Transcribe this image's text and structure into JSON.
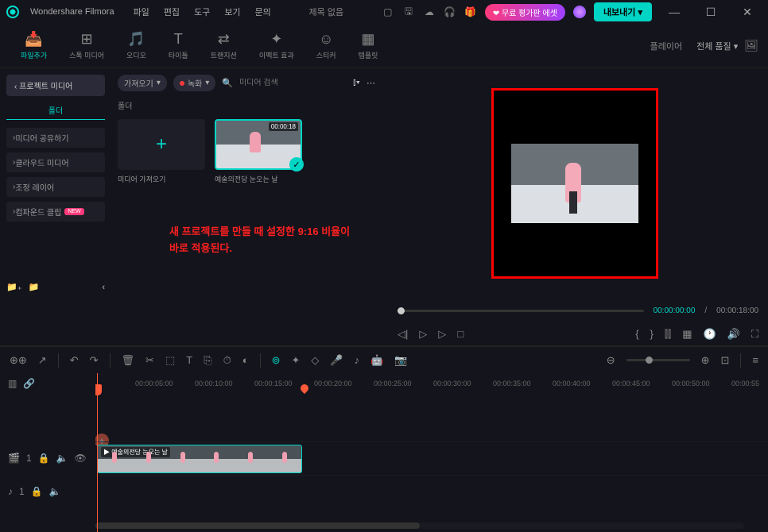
{
  "app": {
    "name": "Wondershare Filmora",
    "title": "제목 없음"
  },
  "menu": [
    "파일",
    "편집",
    "도구",
    "보기",
    "문의"
  ],
  "titlebar_asset": "❤ 무료 평가판 에셋",
  "export_label": "내보내기",
  "tool_tabs": [
    {
      "icon": "📥",
      "label": "파일추가"
    },
    {
      "icon": "⊞",
      "label": "스톡 미디어"
    },
    {
      "icon": "🎵",
      "label": "오디오"
    },
    {
      "icon": "T",
      "label": "타이틀"
    },
    {
      "icon": "⇄",
      "label": "트랜지션"
    },
    {
      "icon": "✦",
      "label": "이펙트 효과"
    },
    {
      "icon": "☺",
      "label": "스티커"
    },
    {
      "icon": "▦",
      "label": "템플릿"
    }
  ],
  "sidebar": {
    "project_media": "‹  프로젝트 미디어",
    "folder": "폴더",
    "items": [
      "미디어 공유하기",
      "클라우드 미디어",
      "조정 레이어",
      "컴파운드 클립"
    ],
    "new_badge": "NEW"
  },
  "media_toolbar": {
    "import": "가져오기",
    "record": "녹화",
    "search_placeholder": "미디어 검색"
  },
  "media_folder_label": "폴더",
  "media_cards": {
    "import_caption": "미디어 가져오기",
    "clip_caption": "예술의전당 눈오는 날",
    "clip_duration": "00:00:18"
  },
  "annotation": "새 프로젝트를 만들 때 설정한 9:16 비율이\n바로 적용된다.",
  "preview": {
    "player_label": "플레이어",
    "quality": "전체 품질"
  },
  "time": {
    "current": "00:00:00:00",
    "total": "00:00:18:00",
    "sep": "/"
  },
  "ruler": [
    "00:00:05:00",
    "00:00:10:00",
    "00:00:15:00",
    "00:00:20:00",
    "00:00:25:00",
    "00:00:30:00",
    "00:00:35:00",
    "00:00:40:00",
    "00:00:45:00",
    "00:00:50:00",
    "00:00:55"
  ],
  "track_clip_label": "예술의전당 눈오는 날",
  "track_video_num": "1",
  "track_audio_num": "1",
  "braces": {
    "open": "{",
    "close": "}"
  }
}
